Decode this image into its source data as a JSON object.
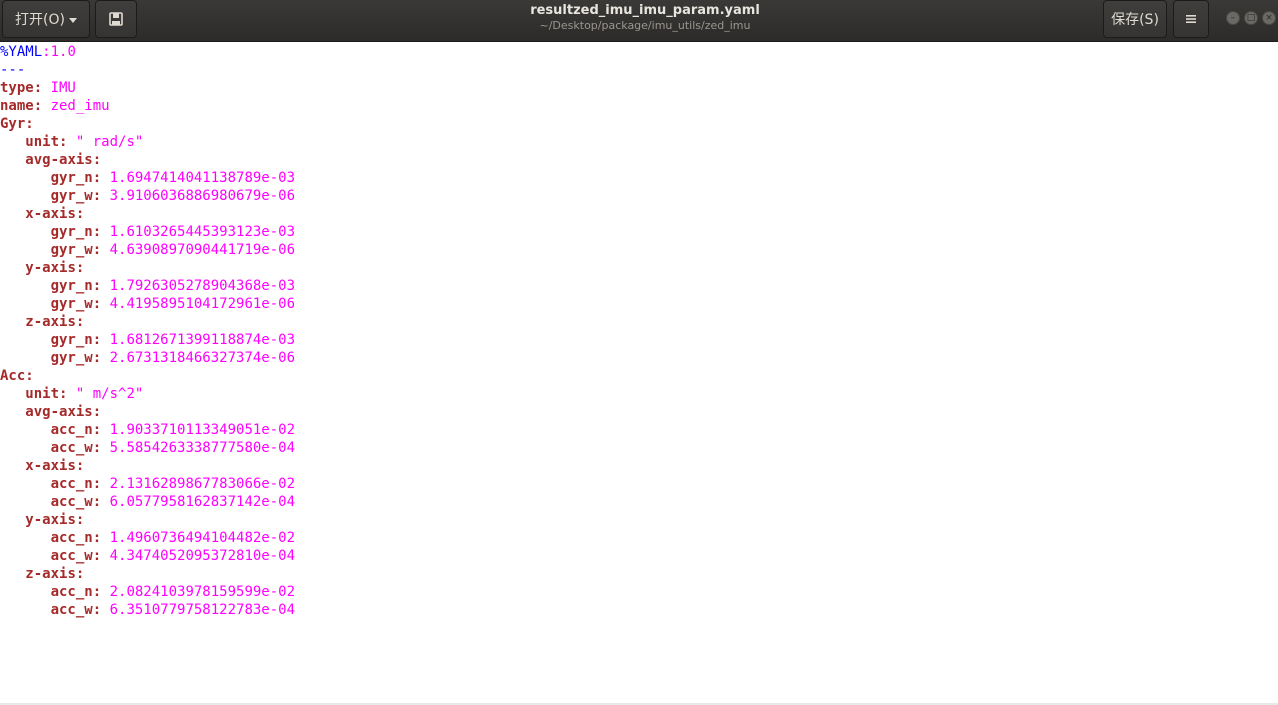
{
  "toolbar": {
    "open_label": "打开(O)",
    "save_label": "保存(S)"
  },
  "window": {
    "title": "resultzed_imu_imu_param.yaml",
    "subtitle": "~/Desktop/package/imu_utils/zed_imu"
  },
  "editor": {
    "lines": [
      {
        "a": "%YAML",
        "b": ":",
        "c": "1.0"
      },
      {
        "a": "---"
      },
      {
        "k": "type",
        "s": ": ",
        "v": "IMU"
      },
      {
        "k": "name",
        "s": ": ",
        "v": "zed_imu"
      },
      {
        "k": "Gyr",
        "s": ":"
      },
      {
        "i": "   ",
        "k": "unit",
        "s": ": ",
        "v": "\" rad/s\""
      },
      {
        "i": "   ",
        "k": "avg-axis",
        "s": ":"
      },
      {
        "i": "      ",
        "k": "gyr_n",
        "s": ": ",
        "v": "1.6947414041138789e-03"
      },
      {
        "i": "      ",
        "k": "gyr_w",
        "s": ": ",
        "v": "3.9106036886980679e-06"
      },
      {
        "i": "   ",
        "k": "x-axis",
        "s": ":"
      },
      {
        "i": "      ",
        "k": "gyr_n",
        "s": ": ",
        "v": "1.6103265445393123e-03"
      },
      {
        "i": "      ",
        "k": "gyr_w",
        "s": ": ",
        "v": "4.6390897090441719e-06"
      },
      {
        "i": "   ",
        "k": "y-axis",
        "s": ":"
      },
      {
        "i": "      ",
        "k": "gyr_n",
        "s": ": ",
        "v": "1.7926305278904368e-03"
      },
      {
        "i": "      ",
        "k": "gyr_w",
        "s": ": ",
        "v": "4.4195895104172961e-06"
      },
      {
        "i": "   ",
        "k": "z-axis",
        "s": ":"
      },
      {
        "i": "      ",
        "k": "gyr_n",
        "s": ": ",
        "v": "1.6812671399118874e-03"
      },
      {
        "i": "      ",
        "k": "gyr_w",
        "s": ": ",
        "v": "2.6731318466327374e-06"
      },
      {
        "k": "Acc",
        "s": ":"
      },
      {
        "i": "   ",
        "k": "unit",
        "s": ": ",
        "v": "\" m/s^2\""
      },
      {
        "i": "   ",
        "k": "avg-axis",
        "s": ":"
      },
      {
        "i": "      ",
        "k": "acc_n",
        "s": ": ",
        "v": "1.9033710113349051e-02"
      },
      {
        "i": "      ",
        "k": "acc_w",
        "s": ": ",
        "v": "5.5854263338777580e-04"
      },
      {
        "i": "   ",
        "k": "x-axis",
        "s": ":"
      },
      {
        "i": "      ",
        "k": "acc_n",
        "s": ": ",
        "v": "2.1316289867783066e-02"
      },
      {
        "i": "      ",
        "k": "acc_w",
        "s": ": ",
        "v": "6.0577958162837142e-04"
      },
      {
        "i": "   ",
        "k": "y-axis",
        "s": ":"
      },
      {
        "i": "      ",
        "k": "acc_n",
        "s": ": ",
        "v": "1.4960736494104482e-02"
      },
      {
        "i": "      ",
        "k": "acc_w",
        "s": ": ",
        "v": "4.3474052095372810e-04"
      },
      {
        "i": "   ",
        "k": "z-axis",
        "s": ":"
      },
      {
        "i": "      ",
        "k": "acc_n",
        "s": ": ",
        "v": "2.0824103978159599e-02"
      },
      {
        "i": "      ",
        "k": "acc_w",
        "s": ": ",
        "v": "6.3510779758122783e-04"
      }
    ]
  },
  "icons": {
    "open_menu": "chevron-down-icon",
    "pin": "bookmark-icon",
    "menu": "hamburger-menu-icon",
    "minimize": "minimize-icon",
    "maximize": "maximize-icon",
    "close": "close-icon"
  },
  "colors": {
    "key": "#a52a2a",
    "value": "#ff00ff",
    "directive": "#0000ff",
    "titlebar": "#2f2e2c"
  }
}
